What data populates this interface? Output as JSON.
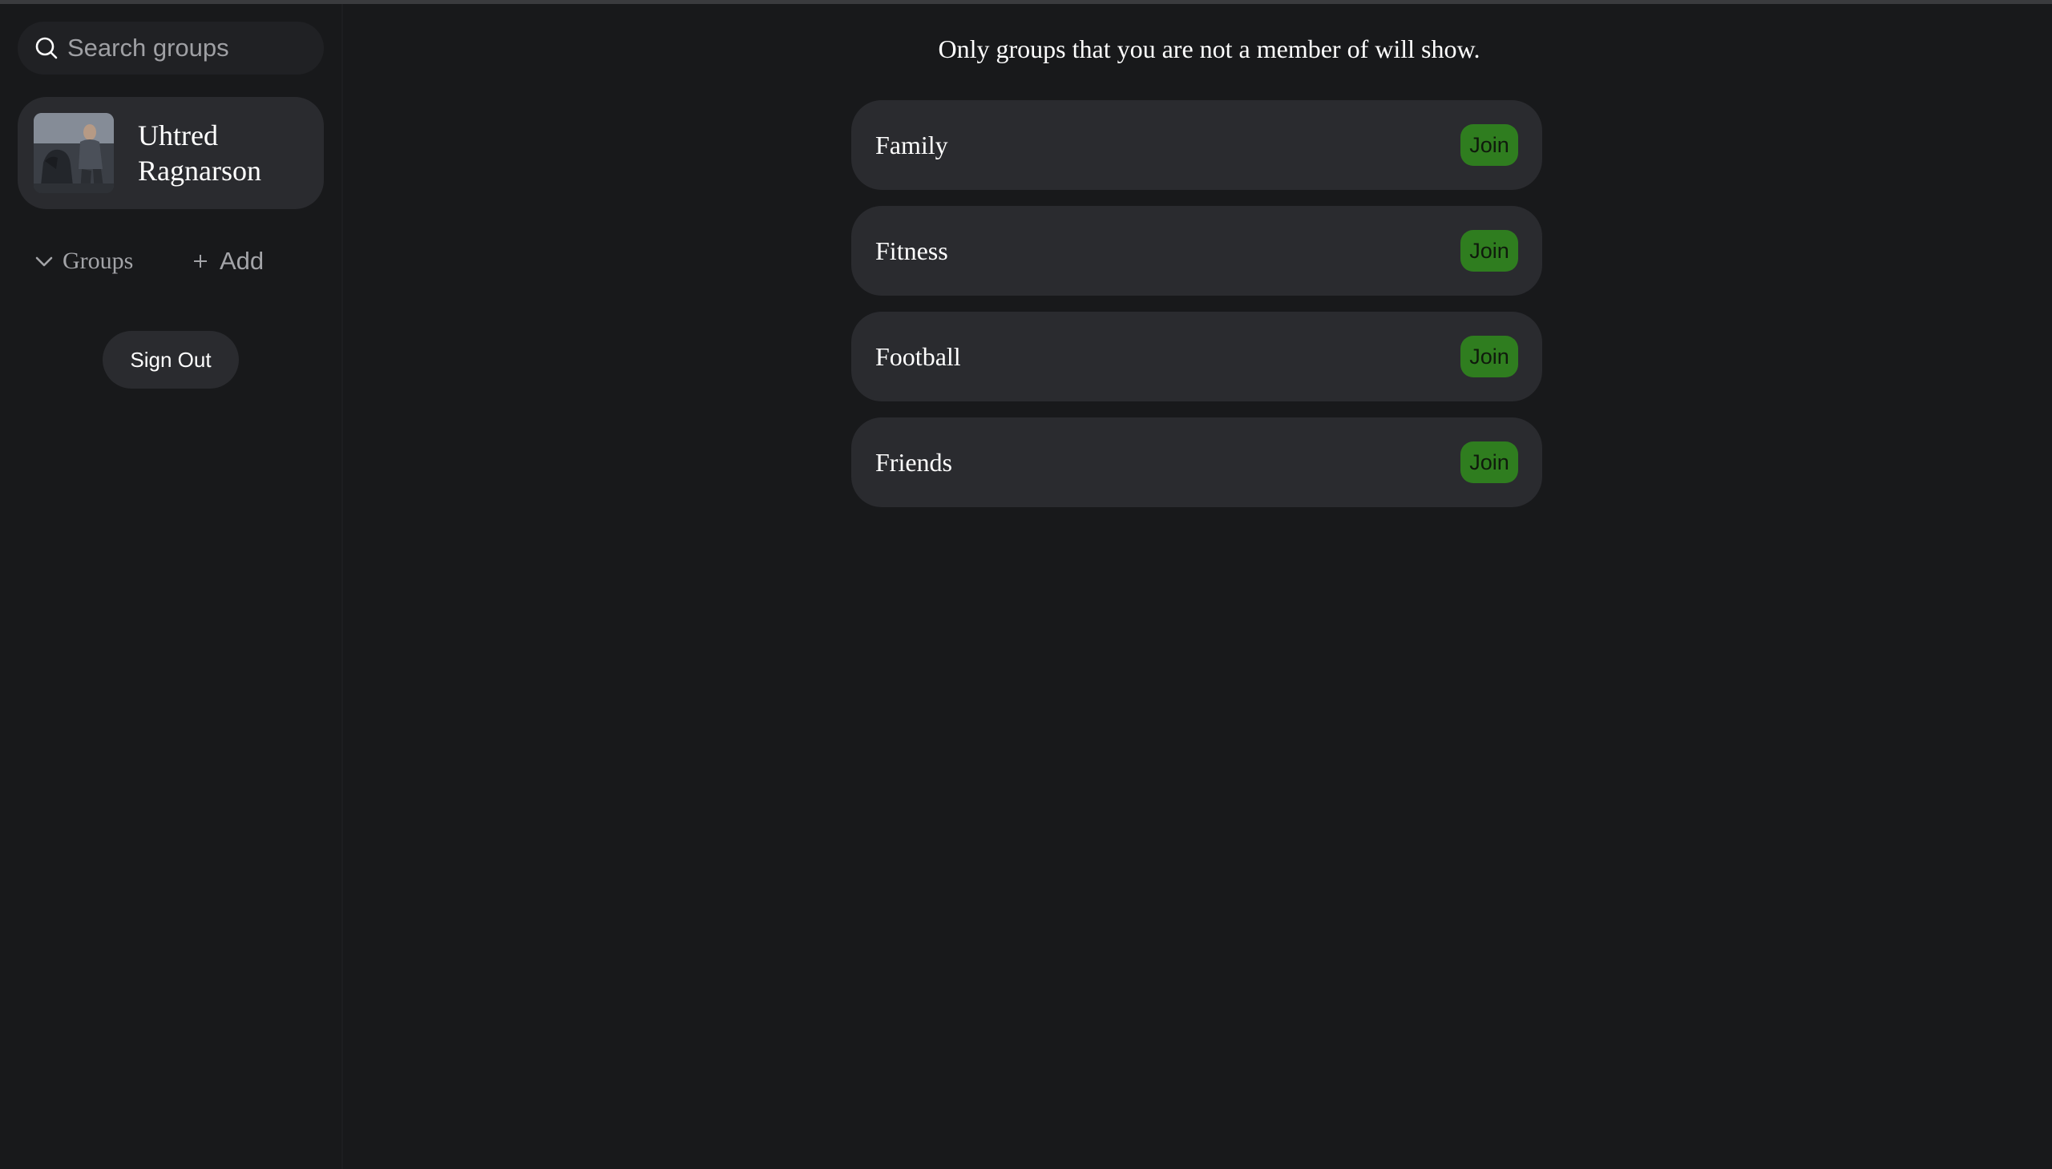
{
  "search": {
    "placeholder": "Search groups",
    "icon": "search-icon"
  },
  "profile": {
    "name": "Uhtred Ragnarson"
  },
  "sidebar": {
    "groups_label": "Groups",
    "groups_icon": "chevron-down-icon",
    "add_label": "Add",
    "add_icon": "plus-icon",
    "signout_label": "Sign Out"
  },
  "main": {
    "notice": "Only groups that you are not a member of will show.",
    "groups": [
      {
        "name": "Family",
        "action": "Join"
      },
      {
        "name": "Fitness",
        "action": "Join"
      },
      {
        "name": "Football",
        "action": "Join"
      },
      {
        "name": "Friends",
        "action": "Join"
      }
    ]
  },
  "colors": {
    "background": "#18191b",
    "card": "#2a2b2f",
    "join_button": "#2f7d1f",
    "muted_text": "#a3a4a8"
  }
}
